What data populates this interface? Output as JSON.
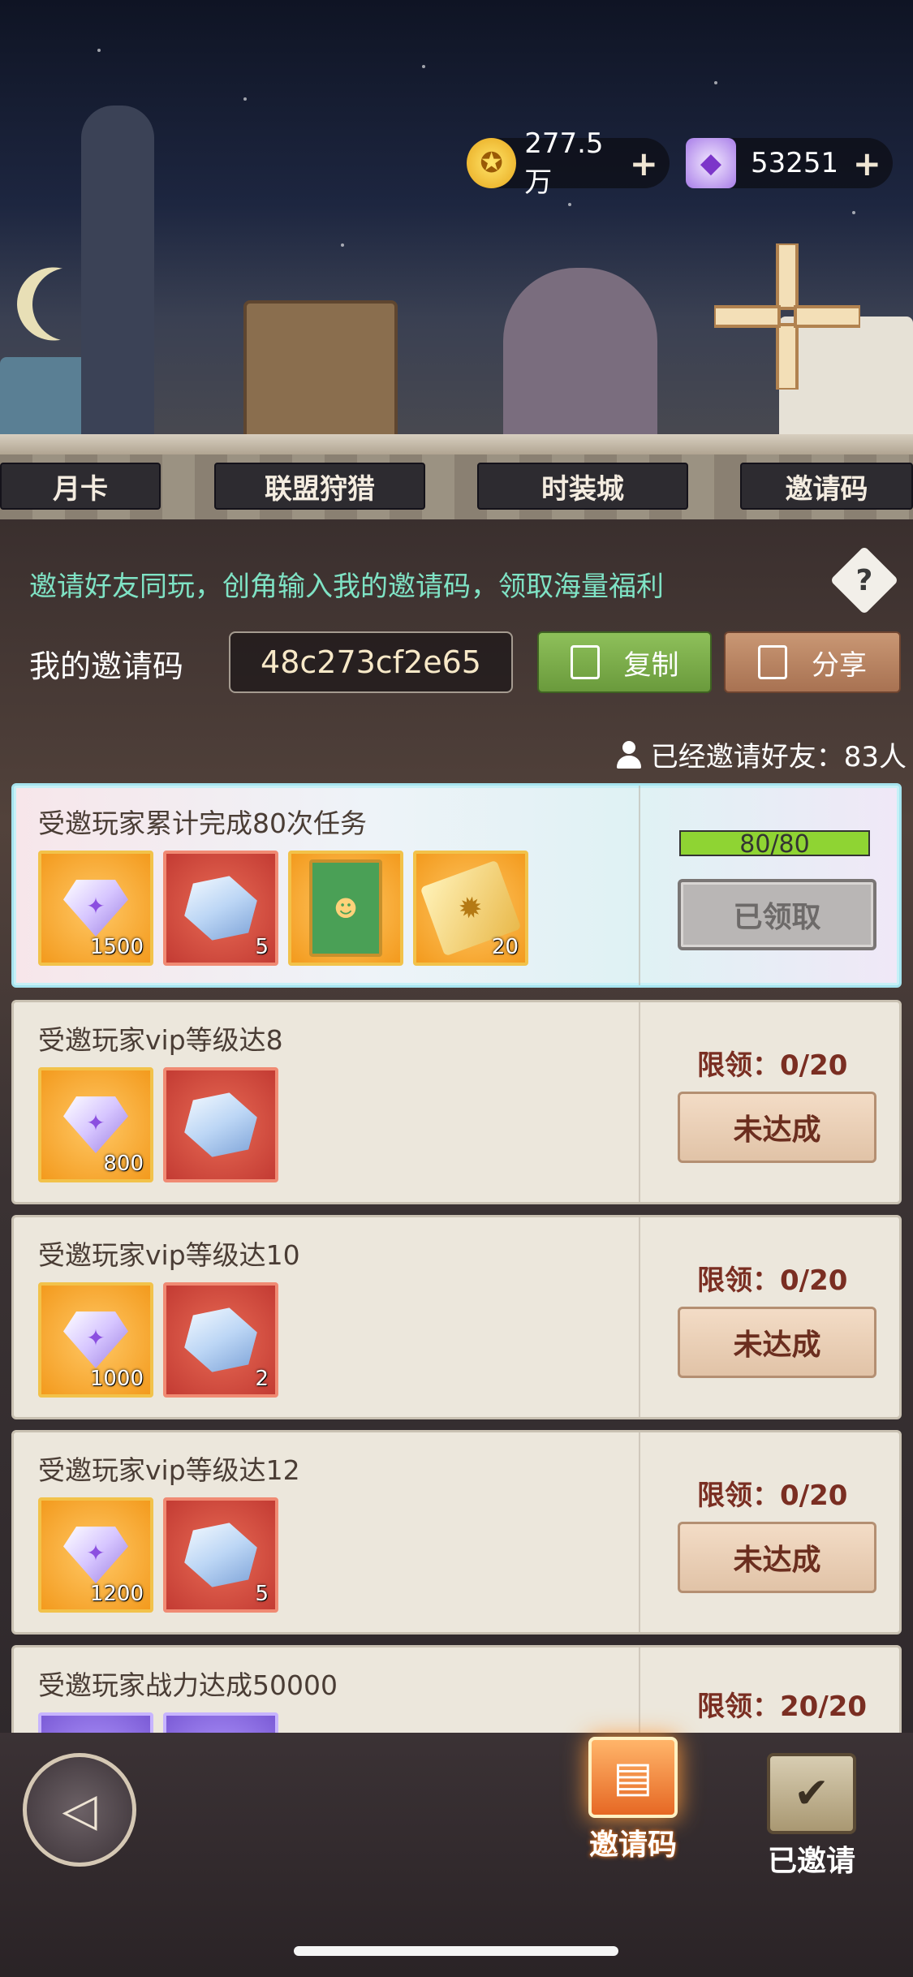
{
  "currency": {
    "gold": "277.5万",
    "gems": "53251"
  },
  "tabs": [
    {
      "label": "月卡"
    },
    {
      "label": "联盟狩猎"
    },
    {
      "label": "时装城"
    },
    {
      "label": "邀请码"
    }
  ],
  "invite": {
    "description": "邀请好友同玩，创角输入我的邀请码，领取海量福利",
    "code_label": "我的邀请码",
    "code": "48c273cf2e65",
    "copy_label": "复制",
    "share_label": "分享",
    "invited_count": "已经邀请好友：83人"
  },
  "tasks": [
    {
      "title": "受邀玩家累计完成80次任务",
      "progress": "80/80",
      "progress_fraction": 1.0,
      "button": "已领取",
      "rewards": [
        {
          "icon": "diamond-icon",
          "count": "1500"
        },
        {
          "icon": "crystal-cube-icon",
          "count": "5"
        },
        {
          "icon": "hero-card-icon",
          "count": ""
        },
        {
          "icon": "gold-scroll-icon",
          "count": "20"
        }
      ]
    },
    {
      "title": "受邀玩家vip等级达8",
      "limit": "限领：0/20",
      "button": "未达成",
      "rewards": [
        {
          "icon": "diamond-icon",
          "count": "800"
        },
        {
          "icon": "crystal-cube-icon",
          "count": ""
        }
      ]
    },
    {
      "title": "受邀玩家vip等级达10",
      "limit": "限领：0/20",
      "button": "未达成",
      "rewards": [
        {
          "icon": "diamond-icon",
          "count": "1000"
        },
        {
          "icon": "crystal-cube-icon",
          "count": "2"
        }
      ]
    },
    {
      "title": "受邀玩家vip等级达12",
      "limit": "限领：0/20",
      "button": "未达成",
      "rewards": [
        {
          "icon": "diamond-icon",
          "count": "1200"
        },
        {
          "icon": "crystal-cube-icon",
          "count": "5"
        }
      ]
    },
    {
      "title": "受邀玩家战力达成50000",
      "limit": "限领：20/20"
    }
  ],
  "bottom_nav": {
    "invite_code": "邀请码",
    "invited": "已邀请"
  }
}
